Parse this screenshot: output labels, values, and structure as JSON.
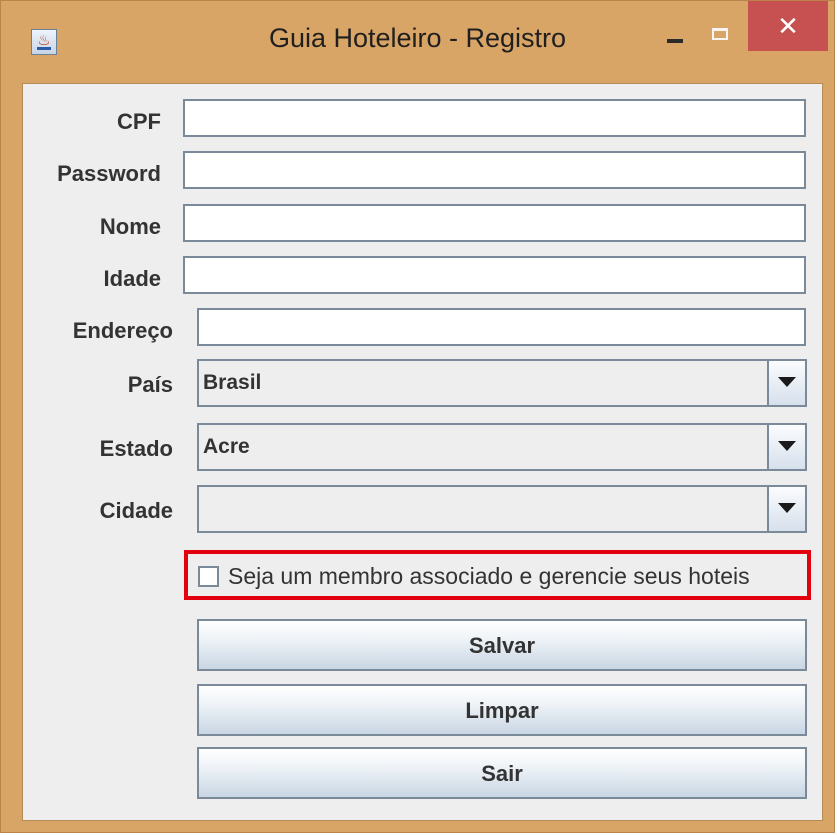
{
  "window": {
    "title": "Guia Hoteleiro - Registro",
    "icon": "java-cup-icon",
    "controls": {
      "minimize": "minimize-icon",
      "maximize": "maximize-icon",
      "close_label": "✕"
    }
  },
  "form": {
    "fields": [
      {
        "label": "CPF",
        "value": ""
      },
      {
        "label": "Password",
        "value": ""
      },
      {
        "label": "Nome",
        "value": ""
      },
      {
        "label": "Idade",
        "value": ""
      },
      {
        "label": "Endereço",
        "value": ""
      }
    ],
    "selects": [
      {
        "label": "País",
        "value": "Brasil"
      },
      {
        "label": "Estado",
        "value": "Acre"
      },
      {
        "label": "Cidade",
        "value": ""
      }
    ],
    "checkbox": {
      "label": "Seja um membro associado e gerencie seus hoteis",
      "checked": false,
      "highlight_color": "#e3000f"
    },
    "buttons": {
      "save": "Salvar",
      "clear": "Limpar",
      "exit": "Sair"
    }
  },
  "colors": {
    "window_frame": "#d9a566",
    "close_button": "#c75050",
    "panel_background": "#eeeeee"
  }
}
